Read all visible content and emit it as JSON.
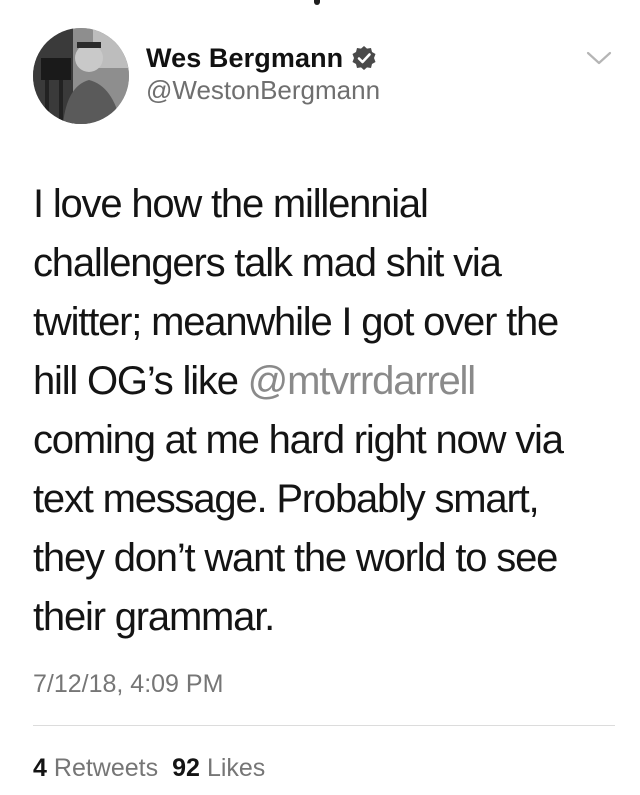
{
  "user": {
    "display_name": "Wes Bergmann",
    "handle": "@WestonBergmann",
    "verified_icon": "verified-badge-icon"
  },
  "menu": {
    "icon": "chevron-down-icon"
  },
  "tweet": {
    "parts": {
      "p1": "I love how the millennial",
      "p2": "challengers talk mad shit via",
      "p3": "twitter; meanwhile I got over the",
      "p4": "hill OG’s like ",
      "mention": "@mtvrrdarrell",
      "p5": "coming at me hard right now via",
      "p6": "text message. Probably smart,",
      "p7": "they don’t want the world to see",
      "p8": "their grammar."
    },
    "timestamp": "7/12/18, 4:09 PM"
  },
  "stats": {
    "retweets_count": "4",
    "retweets_label": "Retweets",
    "likes_count": "92",
    "likes_label": "Likes"
  },
  "colors": {
    "text": "#141414",
    "muted": "#767676",
    "mention": "#8a8a8a"
  }
}
